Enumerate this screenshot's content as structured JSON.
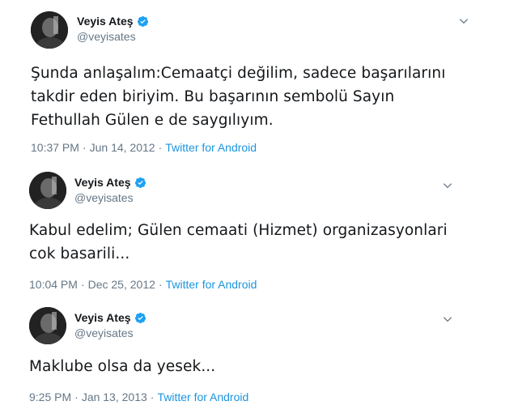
{
  "colors": {
    "text": "#14171a",
    "muted": "#657786",
    "link": "#1b95e0",
    "verified": "#1da1f2"
  },
  "tweets": [
    {
      "display_name": "Veyis Ateş",
      "handle": "@veyisates",
      "text": "Şunda anlaşalım:Cemaatçi değilim, sadece başarılarını\ntakdir eden biriyim. Bu başarının sembolü Sayın\nFethullah Gülen e de saygılıyım.",
      "time": "10:37 PM",
      "separator": "·",
      "date": "Jun 14, 2012",
      "source": "Twitter for Android",
      "icon": "verified-badge-icon"
    },
    {
      "display_name": "Veyis Ateş",
      "handle": "@veyisates",
      "text": "Kabul edelim; Gülen cemaati (Hizmet) organizasyonlari\ncok basarili...",
      "time": "10:04 PM",
      "separator": "·",
      "date": "Dec 25, 2012",
      "source": "Twitter for Android",
      "icon": "verified-badge-icon"
    },
    {
      "display_name": "Veyis Ateş",
      "handle": "@veyisates",
      "text": "Maklube olsa da yesek...",
      "time": "9:25 PM",
      "separator": "·",
      "date": "Jan 13, 2013",
      "source": "Twitter for Android",
      "icon": "verified-badge-icon"
    }
  ]
}
